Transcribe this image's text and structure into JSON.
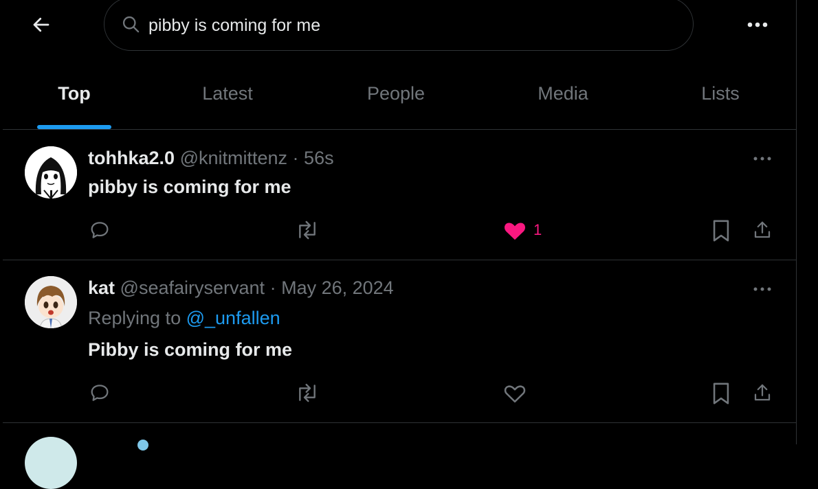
{
  "search": {
    "query": "pibby is coming for me"
  },
  "tabs": [
    {
      "label": "Top",
      "active": true
    },
    {
      "label": "Latest",
      "active": false
    },
    {
      "label": "People",
      "active": false
    },
    {
      "label": "Media",
      "active": false
    },
    {
      "label": "Lists",
      "active": false
    }
  ],
  "tweets": [
    {
      "name": "tohhka2.0",
      "handle": "@knitmittenz",
      "separator": "·",
      "time": "56s",
      "text": "pibby is coming for me",
      "likes": "1",
      "liked": true
    },
    {
      "name": "kat",
      "handle": "@seafairyservant",
      "separator": "·",
      "time": "May 26, 2024",
      "reply_prefix": "Replying to",
      "reply_to": "@_unfallen",
      "text": "Pibby is coming for me",
      "liked": false
    }
  ],
  "colors": {
    "accent": "#1d9bf0",
    "like": "#f91880",
    "muted": "#71767b",
    "border": "#2f3336"
  }
}
